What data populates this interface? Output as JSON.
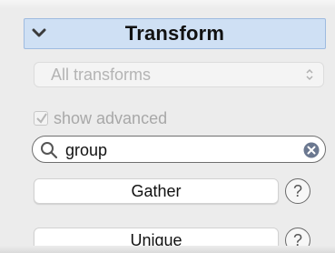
{
  "panel": {
    "title": "Transform",
    "collapse_icon": "chevron-down-icon"
  },
  "filter": {
    "selected": "All transforms",
    "icon": "updown-arrows-icon"
  },
  "advanced": {
    "label": "show advanced",
    "checked": true
  },
  "search": {
    "value": "group",
    "icon": "search-icon",
    "clear_icon": "clear-icon"
  },
  "operations": [
    {
      "label": "Gather",
      "help": "?"
    },
    {
      "label": "Unique",
      "help": "?"
    }
  ],
  "colors": {
    "header_bg": "#cfe0f4",
    "header_border": "#9ebbe0",
    "clear_icon": "#6b7890",
    "disabled_text": "#b4b4b4"
  }
}
